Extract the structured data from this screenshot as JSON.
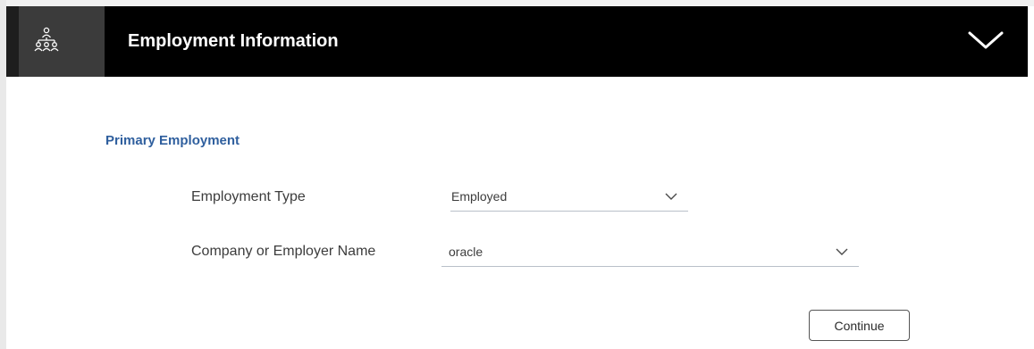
{
  "header": {
    "icon": "organization-icon",
    "title": "Employment Information",
    "collapse_icon": "chevron-down-icon"
  },
  "section": {
    "title": "Primary Employment"
  },
  "fields": {
    "employment_type": {
      "label": "Employment Type",
      "value": "Employed"
    },
    "employer_name": {
      "label": "Company or Employer Name",
      "value": "oracle"
    }
  },
  "actions": {
    "continue_label": "Continue"
  },
  "colors": {
    "header_bg": "#000000",
    "icon_box_bg": "#3b3b3b",
    "section_title": "#2f5f9e"
  }
}
